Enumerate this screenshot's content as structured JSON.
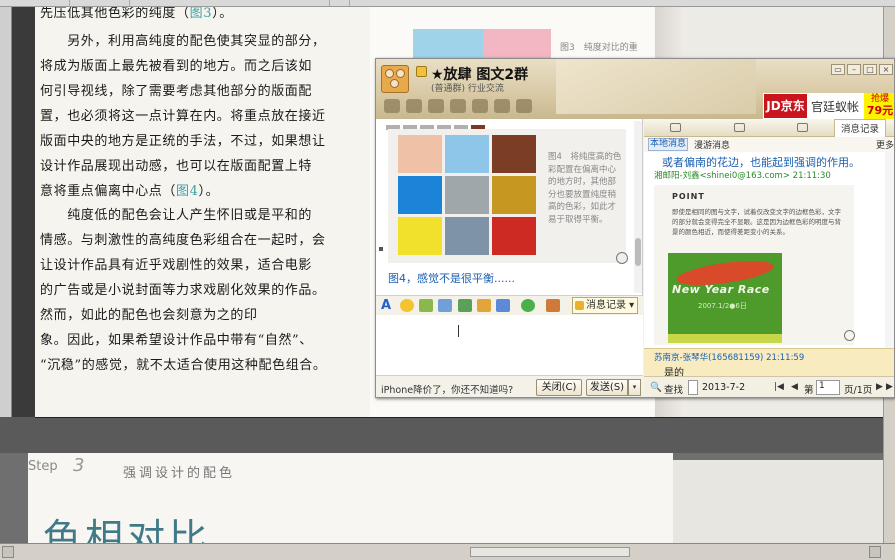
{
  "book": {
    "p1_line0": "先压低其他色彩的纯度（",
    "p1_line0_ref": "图3",
    "p1_line0_end": "）。",
    "p2_lines": [
      "　　另外，利用高纯度的配色使其突显的部分，",
      "将成为版面上最先被看到的地方。而之后该如",
      "何引导视线，除了需要考虑其他部分的版面配",
      "置，也必须将这一点计算在内。将重点放在接近",
      "版面中央的地方是正统的手法，不过，如果想让",
      "设计作品展现出动感，也可以在版面配置上特"
    ],
    "p2_last": "意将重点偏离中心点（",
    "p2_last_ref": "图4",
    "p2_last_end": "）。",
    "p3_lines": [
      "　　纯度低的配色会让人产生怀旧或是平和的",
      "情感。与刺激性的高纯度色彩组合在一起时，会",
      "让设计作品具有近乎戏剧性的效果，适合电影",
      "的广告或是小说封面等力求戏剧化效果的作品。",
      "然而，如此的配色也会刻意为之的印",
      "象。因此，如果希望设计作品中带有“自然”、",
      "“沉稳”的感觉，就不太适合使用这种配色组合。"
    ],
    "caption3": "图3　纯度对比的重",
    "step_label": "Step",
    "step_num": "3",
    "step_title": "强调设计的配色",
    "big_title": "色相对比"
  },
  "qq": {
    "title": "★放肆 图文2群",
    "subtitle": "(普通群) 行业交流",
    "win_buttons": [
      "▭",
      "–",
      "□",
      "×"
    ],
    "ad": {
      "jd": "JD京东",
      "brand": "官廷蚁帐",
      "price_top": "抢爆",
      "price": "79元"
    },
    "colors": [
      "#efc1a6",
      "#8ec6ea",
      "#7b3d24",
      "#1c84d8",
      "#9fa7ab",
      "#c69821",
      "#f2e12c",
      "#7f93a6",
      "#cc2a23"
    ],
    "fig4_caption": "图4　将纯度高的色彩配置在偏离中心的地方时，其他部分也要放置纯度稍高的色彩，如此才易于取得平衡。",
    "chat_message": "图4，感觉不是很平衡......",
    "msglog_label": "消息记录",
    "ad_text": "iPhone降价了，你还不知道吗?",
    "close_label": "关闭(C)",
    "send_label": "发送(S)",
    "history": {
      "tabs": [
        "本地消息",
        "漫游消息"
      ],
      "active_tab": "消息记录",
      "more": "更多",
      "line1": "或者偏南的花边，也能起到强调的作用。",
      "sender1": "湘邮阳-刘鑫<shinei0@163.com> 21:11:30",
      "point": "POINT",
      "point_text": "即使是相同的图与文字，试着仅改变文字的边框色彩，文字的部分就会变得完全不显眼。这是因为边框色彩的明度与背景的颜色相近，而使得差距变小的关系。",
      "card_title": "New Year Race",
      "card_date": "2007.1/2●6日",
      "sender2": "苏南京-张琴华(165681159) 21:11:59",
      "msg2": "是的",
      "search": "查找",
      "date": "2013-7-2",
      "page_label": "第",
      "page": "1",
      "page_total": "页/1页"
    }
  }
}
